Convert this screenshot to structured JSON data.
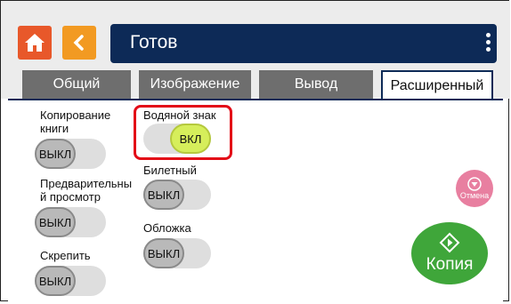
{
  "header": {
    "title": "Готов",
    "home_icon": "home-icon",
    "back_icon": "chevron-left-icon",
    "menu_icon": "kebab-menu-icon"
  },
  "tabs": [
    {
      "label": "Общий",
      "active": false
    },
    {
      "label": "Изображение",
      "active": false
    },
    {
      "label": "Вывод",
      "active": false
    },
    {
      "label": "Расширенный",
      "active": true
    }
  ],
  "settings": {
    "book_copy": {
      "label": "Копирование\nкниги",
      "state": "ВЫКЛ"
    },
    "preview": {
      "label": "Предварительны\nй просмотр",
      "state": "ВЫКЛ"
    },
    "staple": {
      "label": "Скрепить",
      "state": "ВЫКЛ"
    },
    "watermark": {
      "label": "Водяной знак",
      "state": "ВКЛ"
    },
    "ticket": {
      "label": "Билетный",
      "state": "ВЫКЛ"
    },
    "cover": {
      "label": "Обложка",
      "state": "ВЫКЛ"
    }
  },
  "actions": {
    "cancel_label": "Отмена",
    "copy_label": "Копия"
  },
  "colors": {
    "accent_navy": "#0d2a57",
    "home_orange": "#e8582a",
    "back_orange": "#f29a22",
    "on_green": "#d6ee5b",
    "copy_green": "#3fa63a",
    "cancel_pink": "#e87fa0",
    "highlight_red": "#e30b17"
  }
}
